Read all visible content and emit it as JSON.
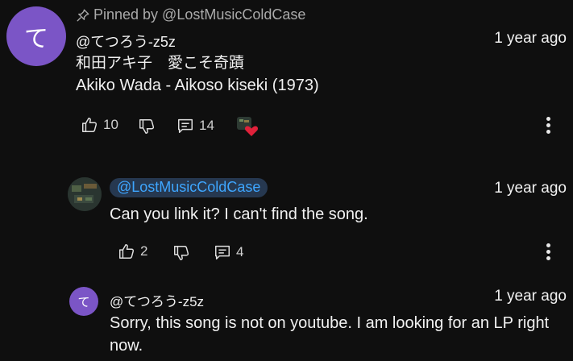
{
  "pinned_comment": {
    "avatar_letter": "て",
    "pinned_label": "Pinned by @LostMusicColdCase",
    "author": "@てつろう-z5z",
    "time": "1 year ago",
    "text_line1": "和田アキ子　愛こそ奇蹟",
    "text_line2": "Akiko Wada - Aikoso kiseki (1973)",
    "likes": "10",
    "replies": "14"
  },
  "reply1": {
    "author_chip": "@LostMusicColdCase",
    "time": "1 year ago",
    "text": "Can you link it? I can't find the song.",
    "likes": "2",
    "replies": "4"
  },
  "reply2": {
    "avatar_letter": "て",
    "author": "@てつろう-z5z",
    "time": "1 year ago",
    "text": "Sorry, this song is not on youtube. I am looking for an LP right now."
  },
  "icons": {
    "pin": "pin-icon",
    "like": "thumbs-up-icon",
    "dislike": "thumbs-down-icon",
    "reply": "comment-icon",
    "more": "more-vertical-icon",
    "heart": "creator-heart-icon"
  },
  "colors": {
    "background": "#0f0f0f",
    "avatar_purple": "#7b55c6",
    "mention_blue": "#3ea6ff",
    "heart_red": "#e0213a"
  }
}
